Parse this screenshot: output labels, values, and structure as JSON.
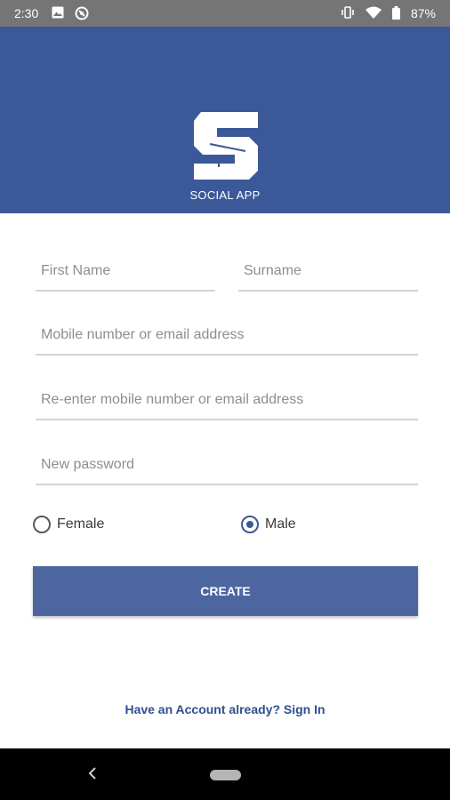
{
  "status_bar": {
    "time": "2:30",
    "battery": "87%",
    "left_icons": [
      "image-icon",
      "sync-icon"
    ],
    "right_icons": [
      "vibrate-icon",
      "wifi-icon",
      "battery-icon"
    ]
  },
  "header": {
    "logo_icon": "s-logo-icon",
    "app_name": "SOCIAL APP",
    "color": "#3b5998"
  },
  "form": {
    "first_name_placeholder": "First Name",
    "surname_placeholder": "Surname",
    "contact_placeholder": "Mobile number or email address",
    "contact_confirm_placeholder": "Re-enter mobile number or email address",
    "password_placeholder": "New password",
    "gender_options": [
      {
        "label": "Female",
        "selected": false
      },
      {
        "label": "Male",
        "selected": true
      }
    ],
    "create_label": "CREATE"
  },
  "footer": {
    "signin_text": "Have an Account already? Sign In"
  },
  "nav_bar": {
    "back_icon": "back-chevron-icon",
    "home_icon": "home-pill-icon"
  }
}
